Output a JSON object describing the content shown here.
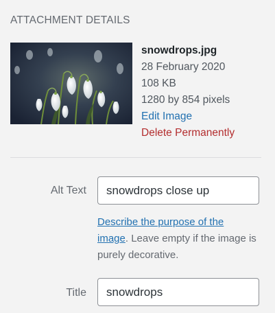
{
  "section_title": "ATTACHMENT DETAILS",
  "attachment": {
    "filename": "snowdrops.jpg",
    "date": "28 February 2020",
    "size": "108 KB",
    "dimensions": "1280 by 854 pixels",
    "edit_link": "Edit Image",
    "delete_link": "Delete Permanently"
  },
  "fields": {
    "alt_text": {
      "label": "Alt Text",
      "value": "snowdrops close up",
      "help_link": "Describe the purpose of the image",
      "help_text": ". Leave empty if the image is purely decorative."
    },
    "title": {
      "label": "Title",
      "value": "snowdrops"
    }
  },
  "colors": {
    "link": "#2271b1",
    "danger": "#b32d2e"
  }
}
